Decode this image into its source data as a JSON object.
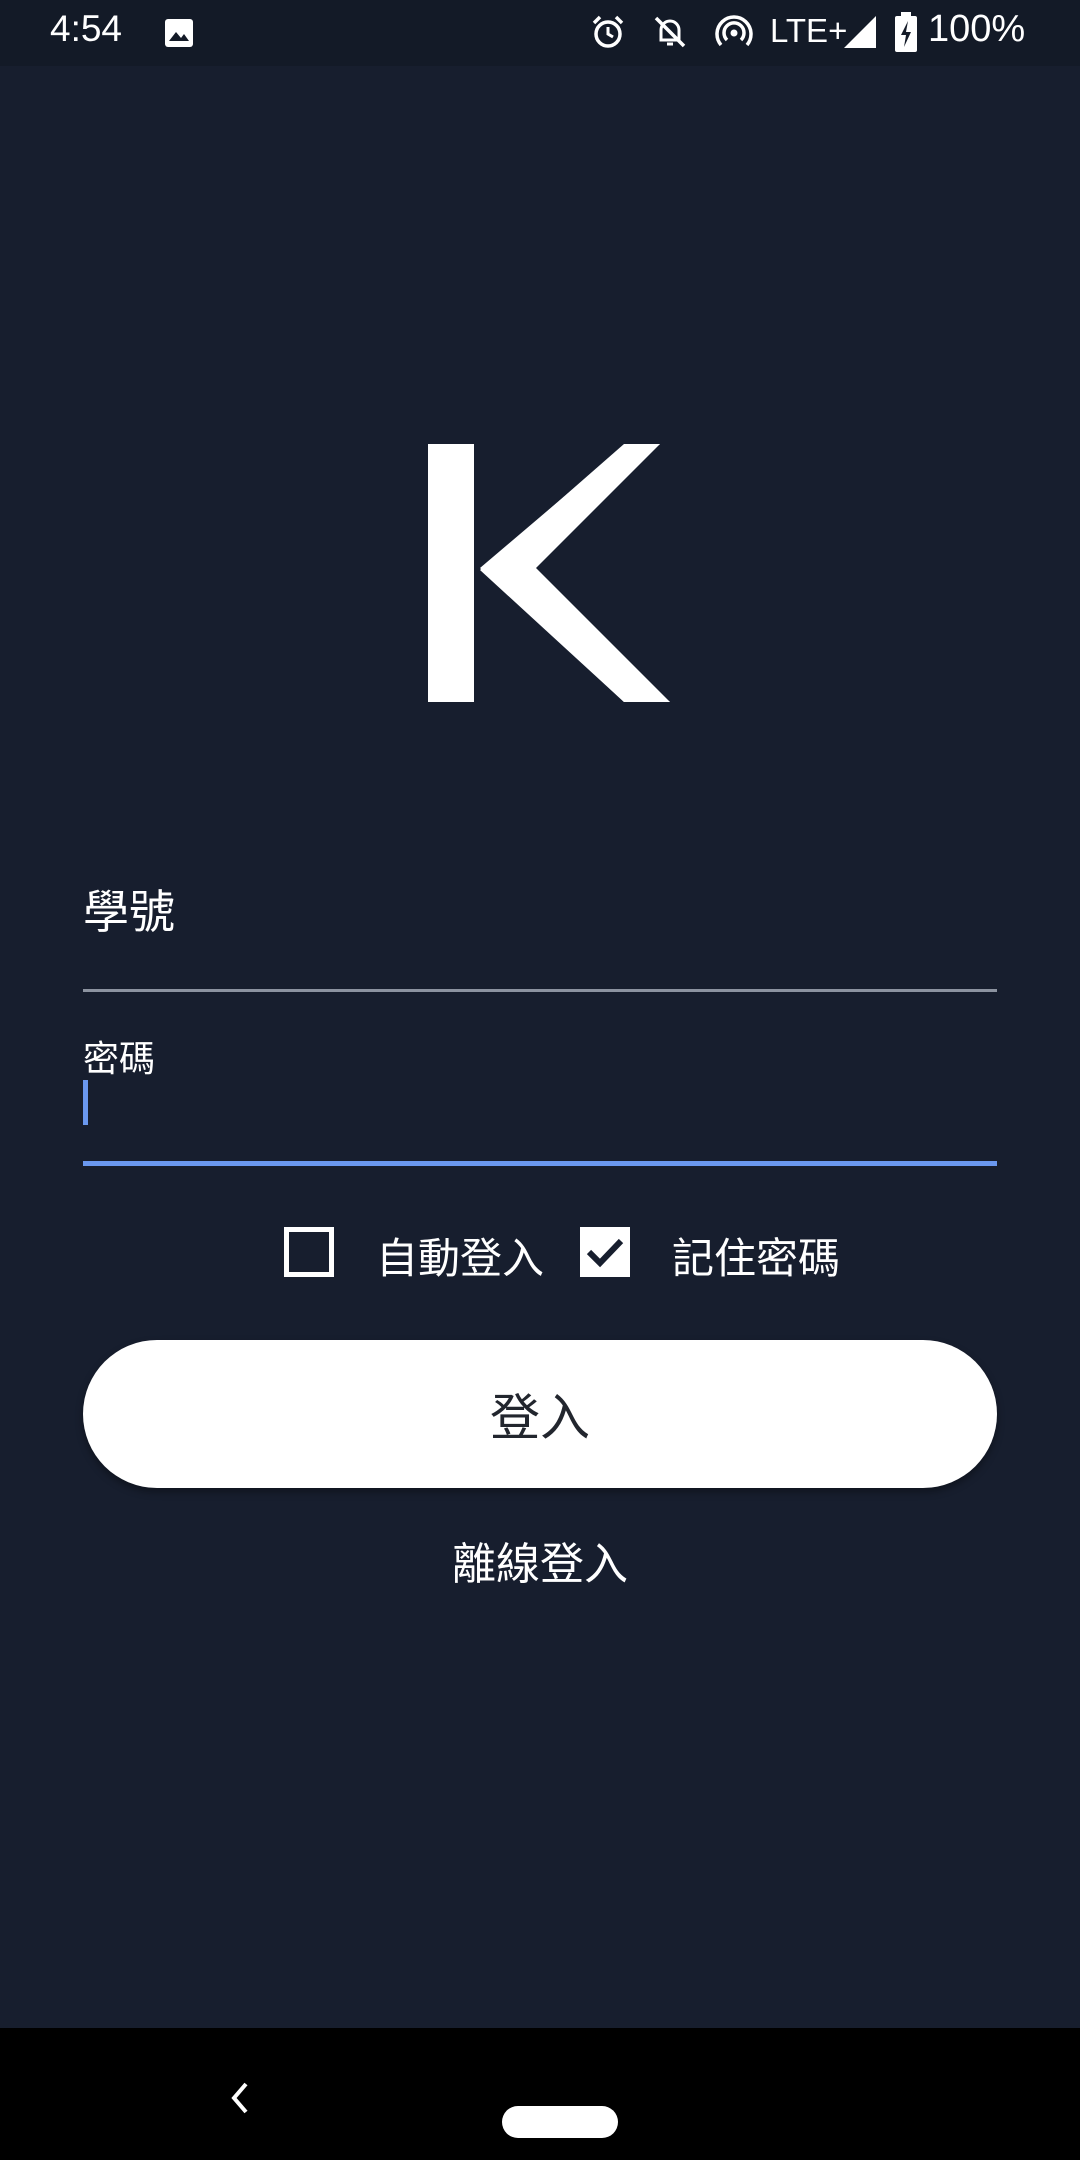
{
  "status_bar": {
    "time": "4:54",
    "network": "LTE+",
    "battery": "100%",
    "icons": [
      "image-icon",
      "alarm-icon",
      "bell-off-icon",
      "hotspot-icon",
      "signal-icon",
      "battery-charging-icon"
    ]
  },
  "logo": {
    "letter_icon": "k-logo-icon"
  },
  "form": {
    "student_id_label": "學號",
    "password_label": "密碼",
    "auto_login_label": "自動登入",
    "auto_login_checked": false,
    "remember_password_label": "記住密碼",
    "remember_password_checked": true
  },
  "actions": {
    "login_label": "登入",
    "offline_login_label": "離線登入"
  },
  "colors": {
    "background": "#171e2e",
    "accent": "#6a98ef",
    "button": "#ffffff"
  }
}
